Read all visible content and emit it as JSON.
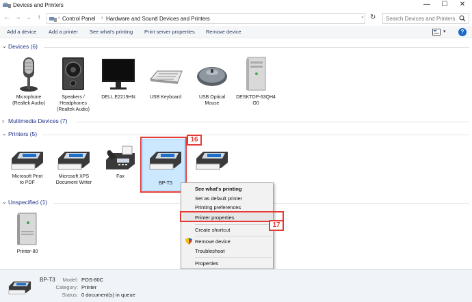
{
  "window": {
    "title": "Devices and Printers",
    "controls": {
      "minimize": "—",
      "maximize": "☐",
      "close": "✕"
    }
  },
  "address_bar": {
    "breadcrumbs": [
      "Control Panel",
      "Hardware and Sound",
      "Devices and Printers"
    ],
    "search_placeholder": "Search Devices and Printers"
  },
  "toolbar": {
    "items": [
      "Add a device",
      "Add a printer",
      "See what's printing",
      "Print server properties",
      "Remove device"
    ],
    "help_label": "?"
  },
  "groups": {
    "devices": {
      "title": "Devices (6)",
      "items": [
        {
          "label_lines": [
            "Microphone",
            "(Realtek Audio)"
          ],
          "icon": "microphone-icon"
        },
        {
          "label_lines": [
            "Speakers /",
            "Headphones",
            "(Realtek Audio)"
          ],
          "icon": "speaker-icon"
        },
        {
          "label_lines": [
            "DELL E2219HN"
          ],
          "icon": "monitor-icon"
        },
        {
          "label_lines": [
            "USB Keyboard"
          ],
          "icon": "keyboard-icon"
        },
        {
          "label_lines": [
            "USB Optical",
            "Mouse"
          ],
          "icon": "mouse-icon"
        },
        {
          "label_lines": [
            "DESKTOP-63QH4",
            "O0"
          ],
          "icon": "computer-tower-icon"
        }
      ]
    },
    "multimedia": {
      "title": "Multimedia Devices (7)"
    },
    "printers": {
      "title": "Printers (5)",
      "items": [
        {
          "label_lines": [
            "Microsoft Print",
            "to PDF"
          ],
          "icon": "printer-icon"
        },
        {
          "label_lines": [
            "Microsoft XPS",
            "Document Writer"
          ],
          "icon": "printer-icon"
        },
        {
          "label_lines": [
            "Fax"
          ],
          "icon": "fax-icon"
        },
        {
          "label_lines": [
            "BP-T3"
          ],
          "icon": "printer-icon"
        },
        {
          "label_lines": [
            ""
          ],
          "icon": "printer-icon"
        }
      ]
    },
    "unspecified": {
      "title": "Unspecified (1)",
      "items": [
        {
          "label_lines": [
            "Printer-80"
          ],
          "icon": "server-icon"
        }
      ]
    }
  },
  "annotations": {
    "step1": "16",
    "step2": "17"
  },
  "context_menu": {
    "items": [
      {
        "label": "See what's printing",
        "bold": true
      },
      {
        "label": "Set as default printer"
      },
      {
        "label": "Printing preferences"
      },
      {
        "label": "Printer properties",
        "highlighted": true
      },
      {
        "separator": true
      },
      {
        "label": "Create shortcut"
      },
      {
        "separator": true
      },
      {
        "label": "Remove device",
        "icon": "shield-icon"
      },
      {
        "label": "Troubleshoot"
      },
      {
        "separator": true
      },
      {
        "label": "Properties"
      }
    ]
  },
  "details": {
    "name": "BP-T3",
    "fields": [
      {
        "key": "Model:",
        "value": "POS-80C"
      },
      {
        "key": "Category:",
        "value": "Printer"
      },
      {
        "key": "Status:",
        "value": "0 document(s) in queue"
      }
    ]
  }
}
